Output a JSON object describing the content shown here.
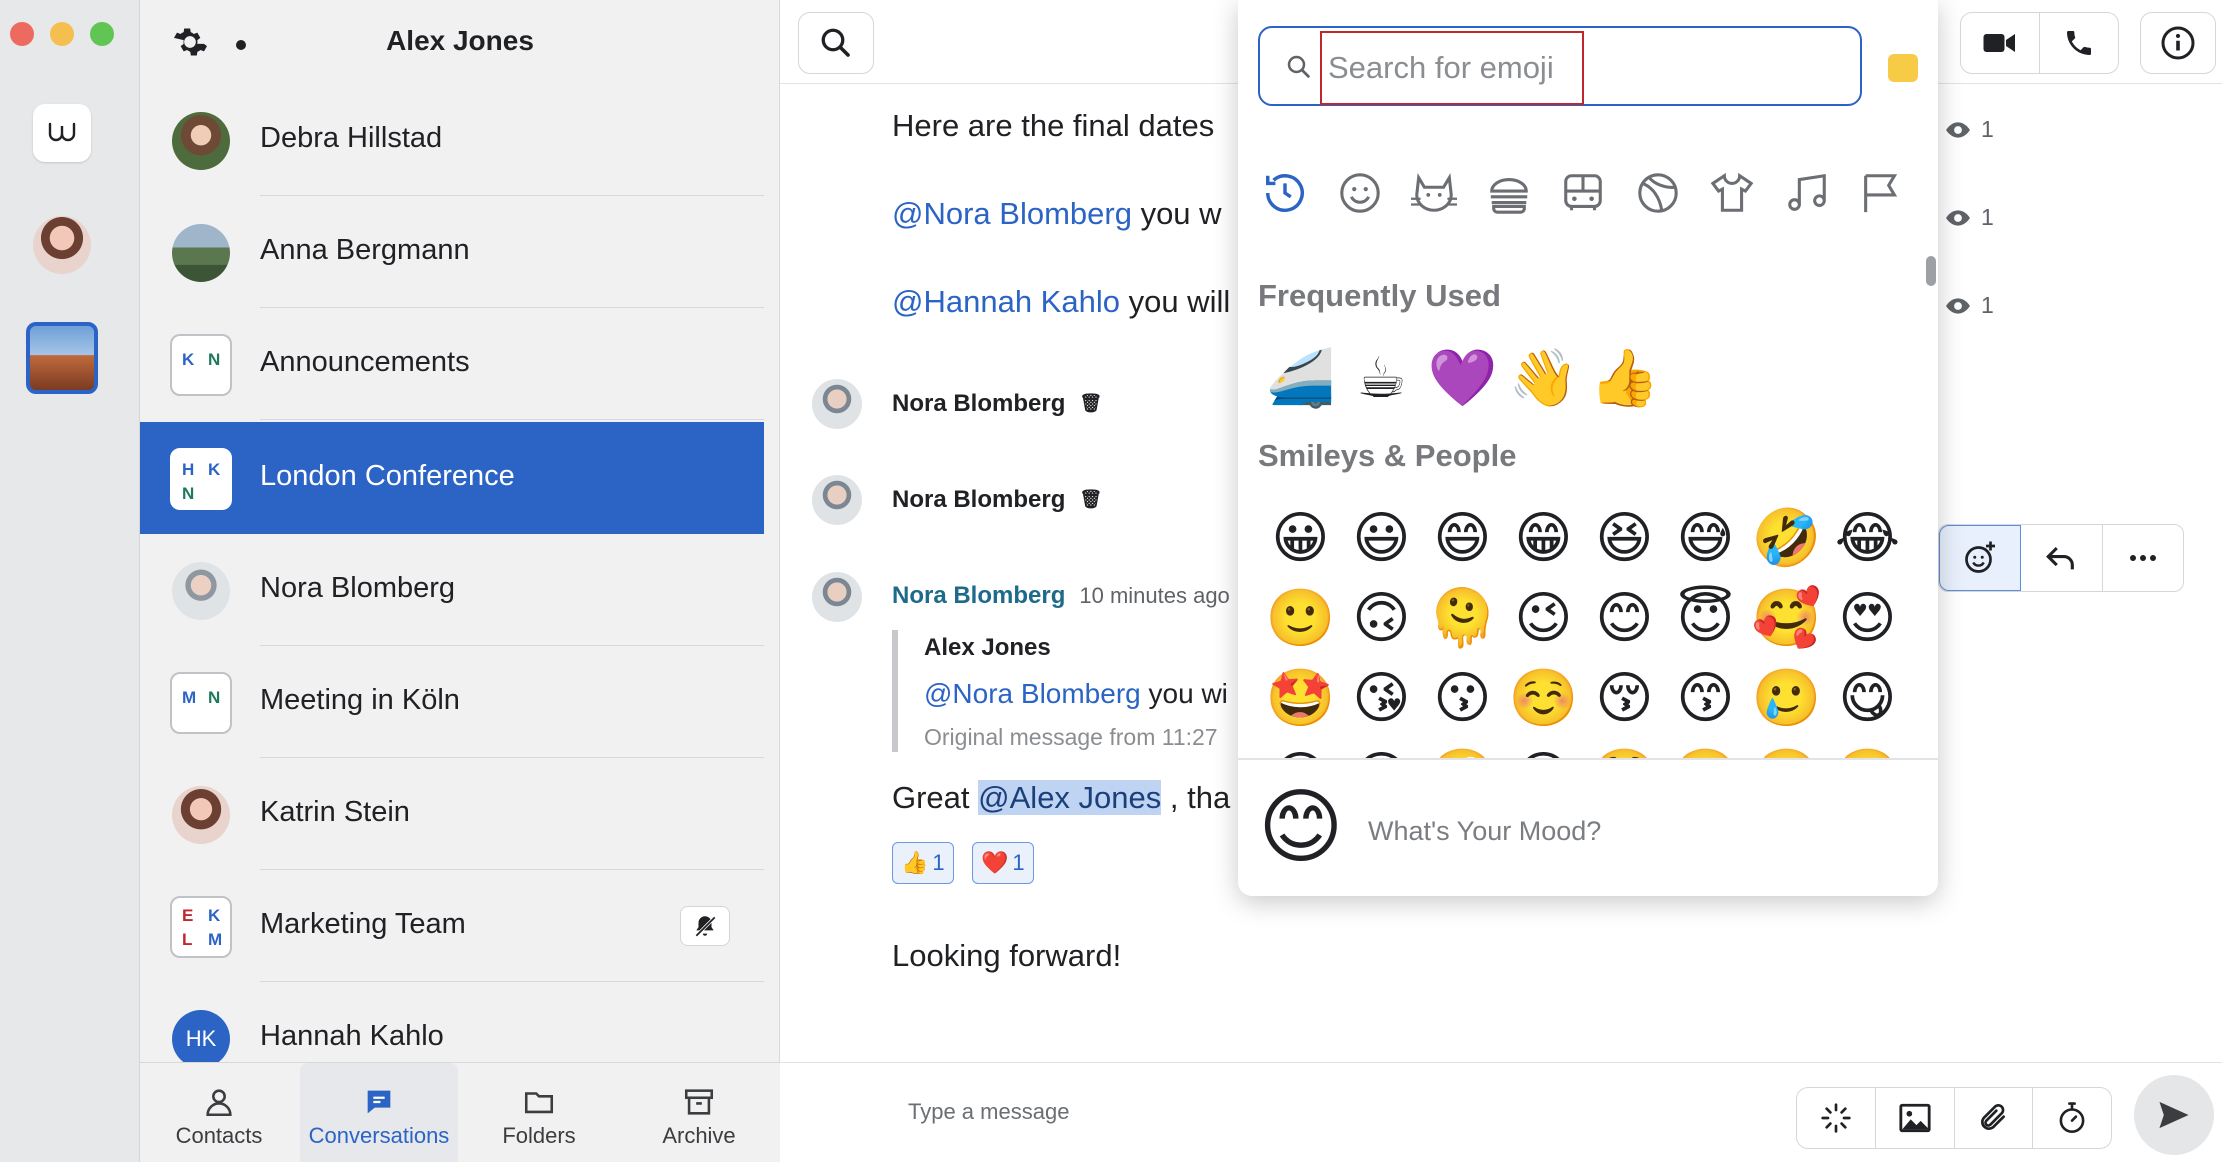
{
  "sidebar": {
    "title": "Alex Jones",
    "conversations": [
      {
        "name": "Debra Hillstad"
      },
      {
        "name": "Anna Bergmann"
      },
      {
        "name": "Announcements",
        "initials": [
          "K",
          "N"
        ]
      },
      {
        "name": "London Conference",
        "initials": [
          "H",
          "K",
          "N"
        ]
      },
      {
        "name": "Nora Blomberg"
      },
      {
        "name": "Meeting in Köln",
        "initials": [
          "M",
          "N"
        ]
      },
      {
        "name": "Katrin Stein"
      },
      {
        "name": "Marketing Team",
        "initials": [
          "E",
          "K",
          "L",
          "M"
        ]
      },
      {
        "name": "Hannah Kahlo",
        "initials": [
          "HK"
        ]
      }
    ],
    "tabs": [
      {
        "label": "Contacts"
      },
      {
        "label": "Conversations"
      },
      {
        "label": "Folders"
      },
      {
        "label": "Archive"
      }
    ]
  },
  "chat": {
    "messages": {
      "final_dates": "Here are the final dates",
      "nora_mention": "@Nora Blomberg",
      "nora_rest": " you w",
      "hannah_mention": "@Hannah Kahlo",
      "hannah_rest": " you will",
      "seen_count": "1",
      "sender_name": "Nora Blomberg",
      "time": "10 minutes ago",
      "quote_author": "Alex Jones",
      "quote_mention": "@Nora Blomberg",
      "quote_rest": " you wi",
      "quote_meta": "Original message from 11:27",
      "reply_prefix": "Great ",
      "reply_mention": "@Alex Jones",
      "reply_rest": " , tha",
      "reaction_thumbs_count": "1",
      "reaction_heart_count": "1",
      "final": "Looking forward!"
    },
    "composer_placeholder": "Type a message"
  },
  "emoji_picker": {
    "search_placeholder": "Search for emoji",
    "frequently_used_heading": "Frequently Used",
    "smileys_heading": "Smileys & People",
    "frequently_used": [
      "🚄",
      "☕",
      "💜",
      "👋",
      "👍"
    ],
    "smileys": [
      "😀",
      "😃",
      "😄",
      "😁",
      "😆",
      "😅",
      "🤣",
      "😂",
      "🙂",
      "🙃",
      "🫠",
      "😉",
      "😊",
      "😇",
      "🥰",
      "😍",
      "🤩",
      "😘",
      "😗",
      "☺️",
      "😚",
      "😙",
      "🥲",
      "😋",
      "😛",
      "😜",
      "🤪",
      "😝",
      "🤑",
      "🤗",
      "🤭",
      "🫢"
    ],
    "mood_emoji": "😊",
    "mood_text": "What's Your Mood?"
  },
  "reactions": {
    "thumbs": "👍",
    "heart": "❤️"
  }
}
